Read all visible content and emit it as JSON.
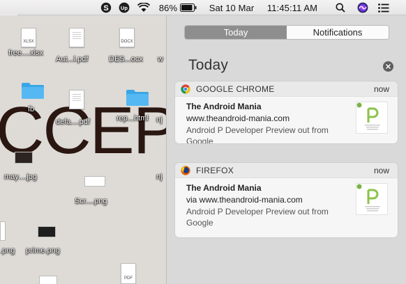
{
  "menubar": {
    "battery_percent": "86%",
    "date": "Sat 10 Mar",
    "time": "11:45:11 AM",
    "icons": [
      "skype-icon",
      "upwork-icon",
      "wifi-icon",
      "battery-icon",
      "search-icon",
      "siri-icon",
      "notification-center-icon"
    ]
  },
  "desktop": {
    "background_text": "CCEP",
    "files": [
      {
        "label": "free....xlsx",
        "tag": "XLSX"
      },
      {
        "label": "Aut...l.pdf"
      },
      {
        "label": "DES...ocx",
        "tag": "DOCX"
      },
      {
        "label": "w"
      },
      {
        "label": "fb"
      },
      {
        "label": "defa....pdf"
      },
      {
        "label": "rep...html"
      },
      {
        "label": "nj"
      },
      {
        "label": "may....jpg"
      },
      {
        "label": "nj"
      },
      {
        "label": "Scr....png"
      },
      {
        "label": ".png"
      },
      {
        "label": "prime.png"
      },
      {
        "label": "PDF",
        "tag": "PDF"
      }
    ]
  },
  "notification_center": {
    "tabs": [
      {
        "label": "Today",
        "selected": true
      },
      {
        "label": "Notifications",
        "selected": false
      }
    ],
    "heading": "Today",
    "notifications": [
      {
        "app": "GOOGLE CHROME",
        "app_icon": "chrome-icon",
        "time": "now",
        "title": "The Android Mania",
        "subtitle": "www.theandroid-mania.com",
        "message": "Android P Developer Preview out from Google"
      },
      {
        "app": "FIREFOX",
        "app_icon": "firefox-icon",
        "time": "now",
        "title": "The Android Mania",
        "subtitle": "via www.theandroid-mania.com",
        "message": "Android P Developer Preview out from Google"
      }
    ]
  },
  "colors": {
    "segment_selected": "#8e8e8e",
    "panel_background": "#dad9d9",
    "card_background": "#f6f6f6",
    "android_p_green": "#8bc34a"
  }
}
